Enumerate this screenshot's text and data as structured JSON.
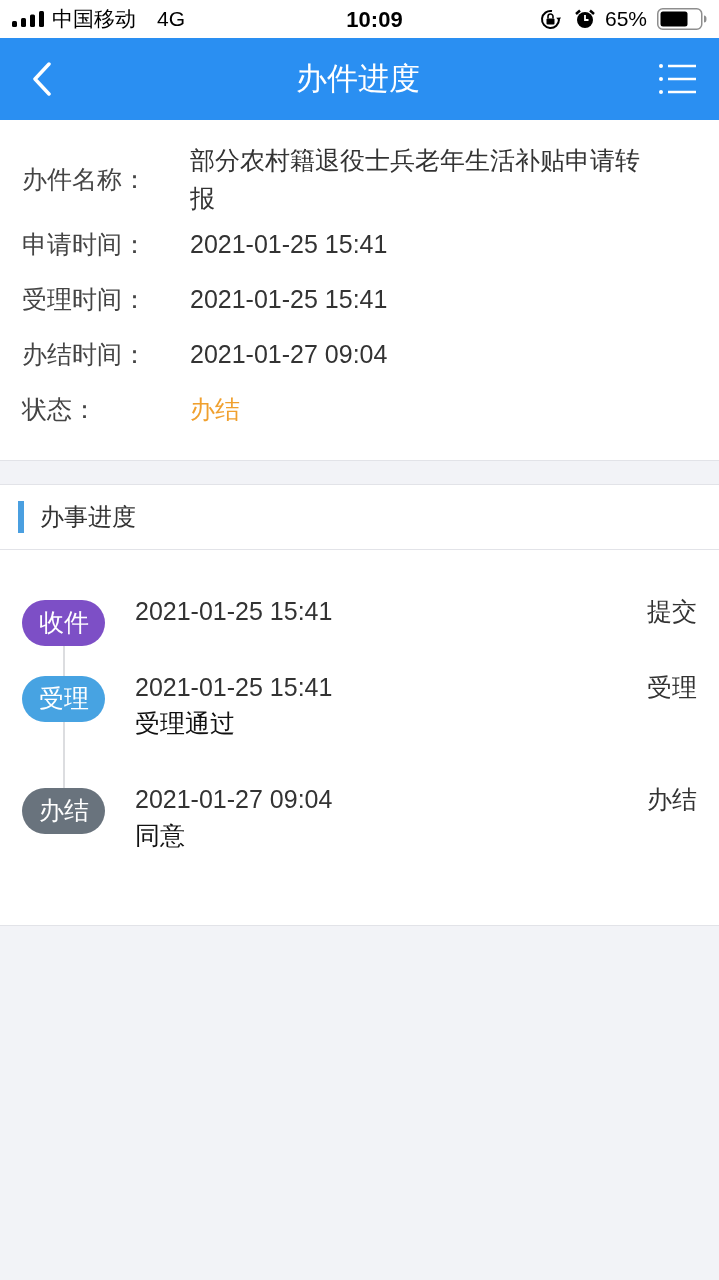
{
  "status_bar": {
    "carrier": "中国移动",
    "network": "4G",
    "time": "10:09",
    "battery": "65%"
  },
  "nav_bar": {
    "title": "办件进度"
  },
  "details": [
    {
      "kind": "text",
      "label": "办件名称：",
      "value": "部分农村籍退役士兵老年生活补贴申请转报"
    },
    {
      "kind": "text",
      "label": "申请时间：",
      "value": "2021-01-25 15:41"
    },
    {
      "kind": "text",
      "label": "受理时间：",
      "value": "2021-01-25 15:41"
    },
    {
      "kind": "text",
      "label": "办结时间：",
      "value": "2021-01-27 09:04"
    },
    {
      "kind": "status",
      "label": "状态：",
      "value": "办结"
    }
  ],
  "progress": {
    "title": "办事进度",
    "steps": [
      {
        "badge": "收件",
        "color": "#7d4fc6",
        "time": "2021-01-25 15:41",
        "action": "提交"
      },
      {
        "badge": "受理",
        "color": "#47a3e2",
        "time": "2021-01-25 15:41",
        "action": "受理",
        "note": "受理通过"
      },
      {
        "badge": "办结",
        "color": "#69737d",
        "time": "2021-01-27 09:04",
        "action": "办结",
        "note": "同意"
      }
    ]
  }
}
